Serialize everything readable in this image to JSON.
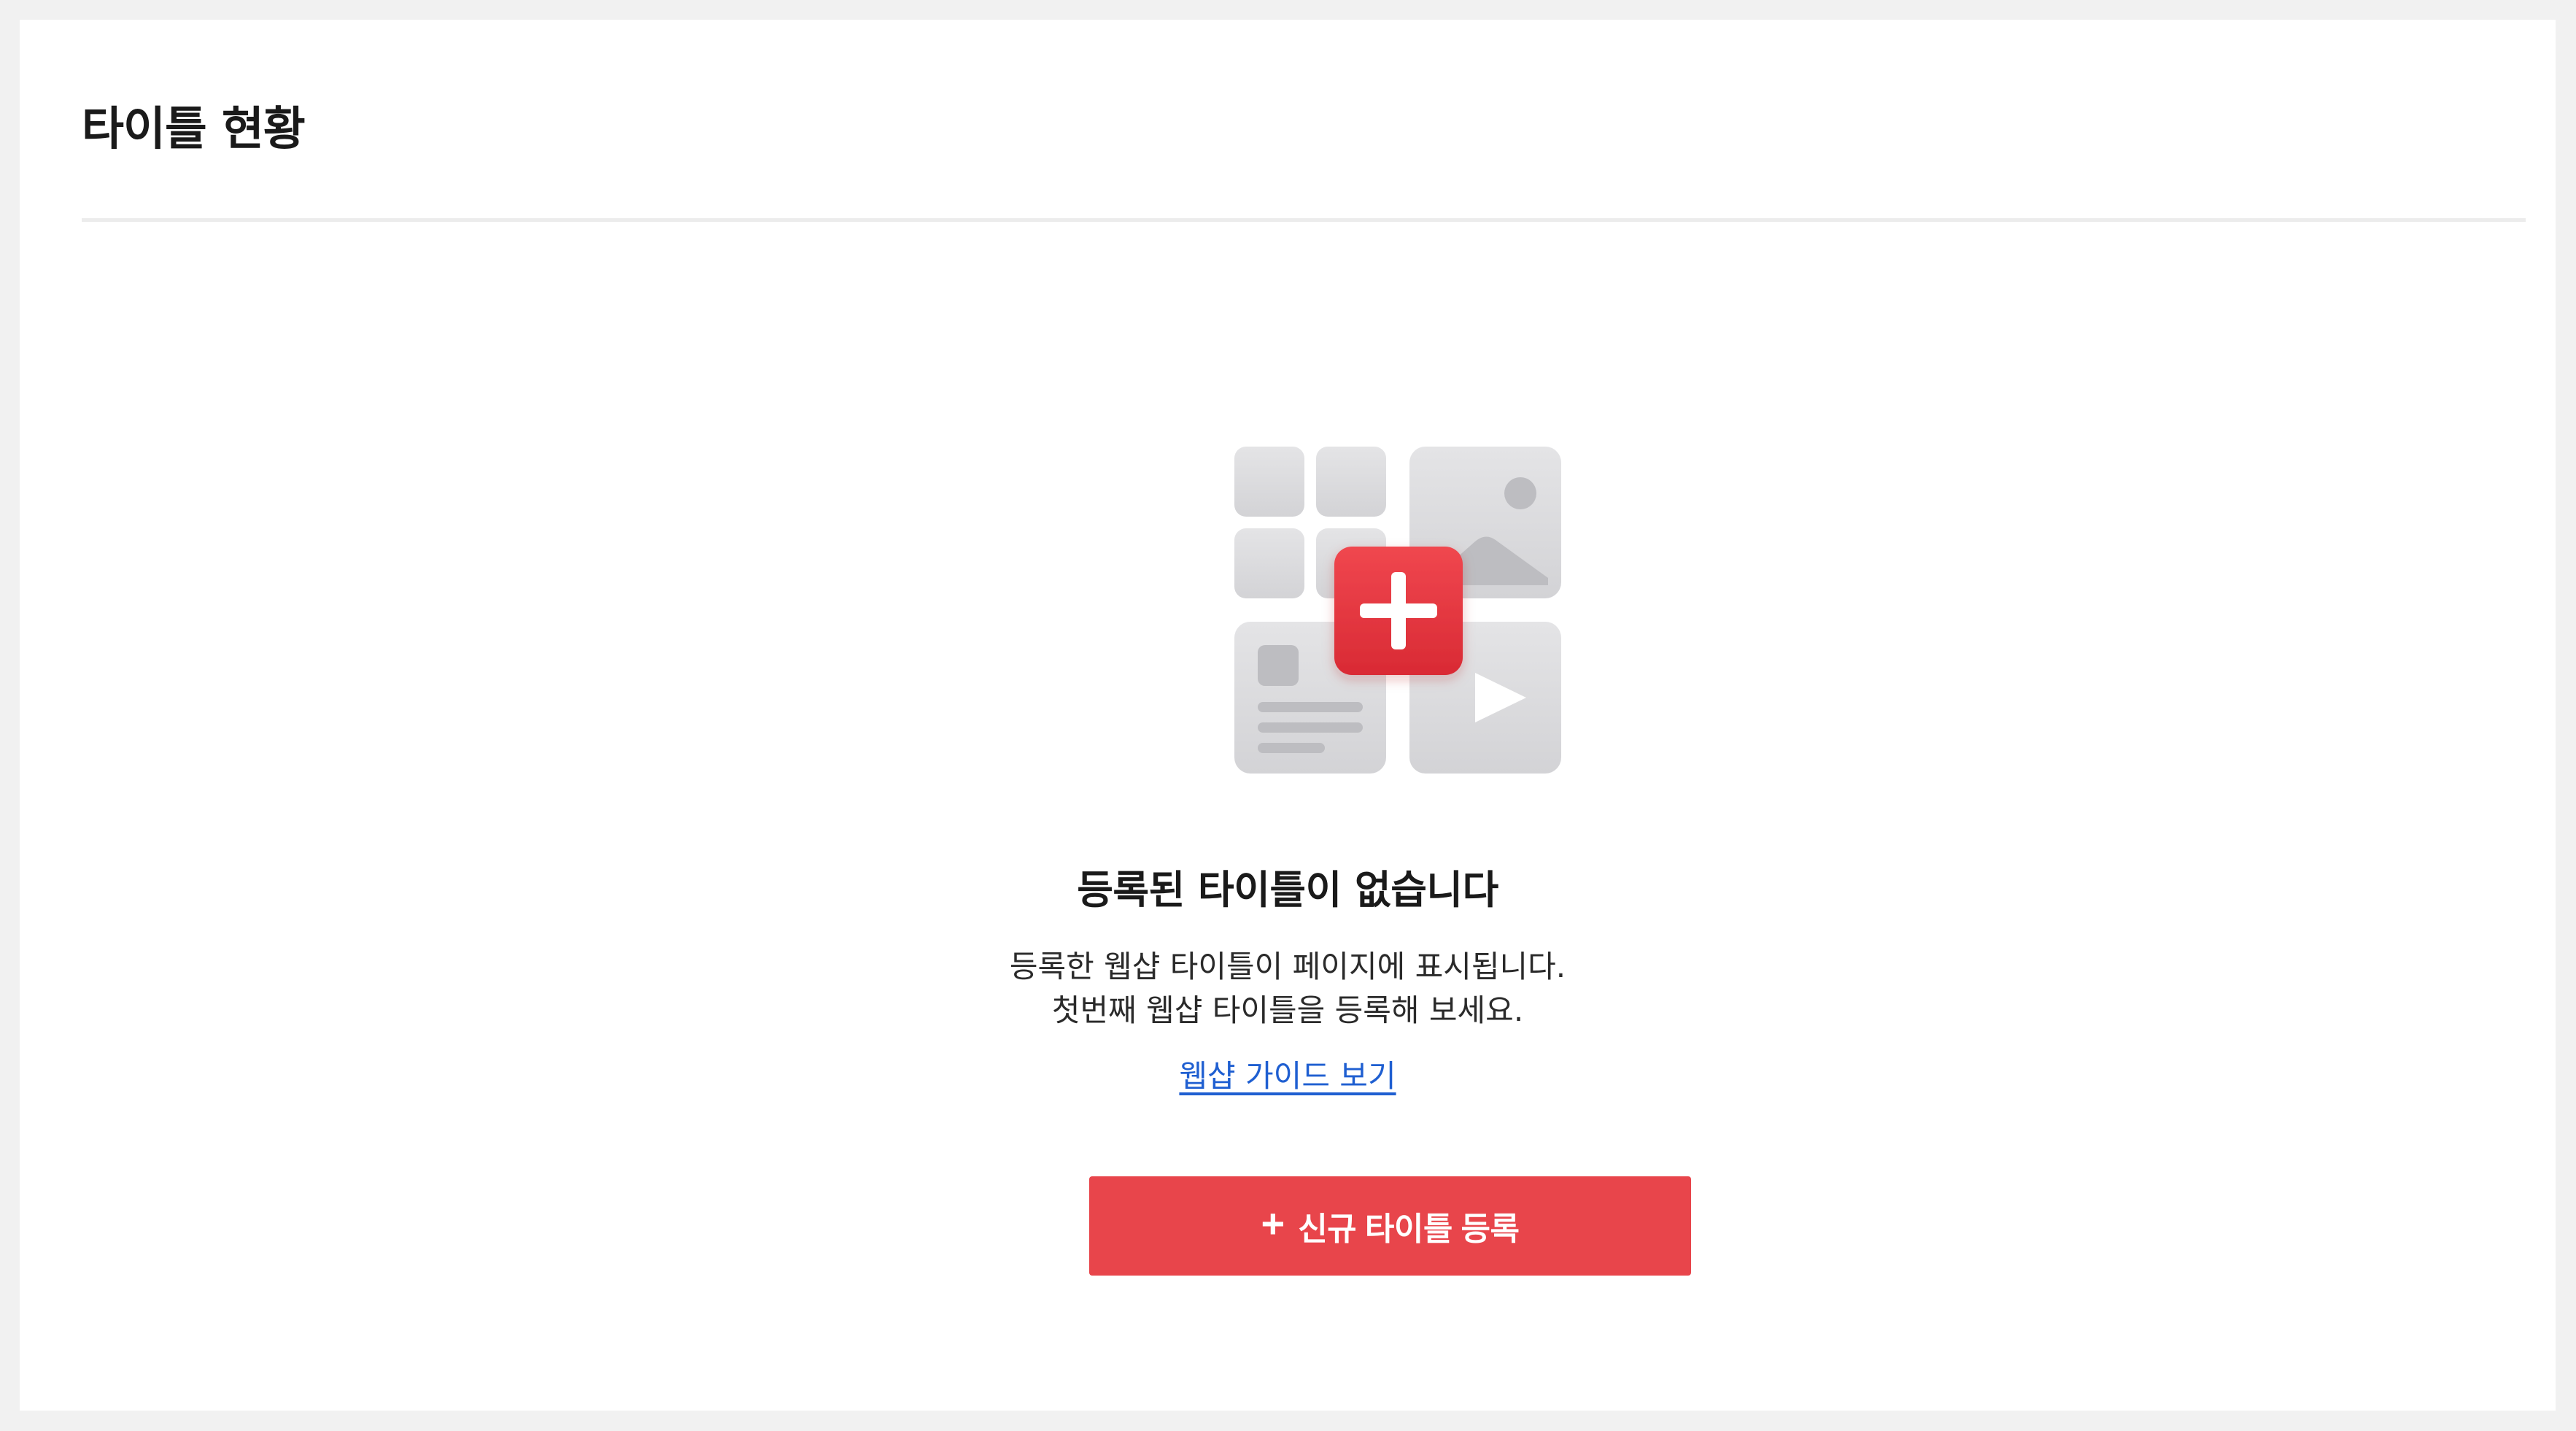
{
  "page": {
    "title": "타이틀 현황"
  },
  "empty_state": {
    "illustration_icon": "add-content-grid-icon",
    "title": "등록된 타이틀이 없습니다",
    "description_line1": "등록한 웹샵 타이틀이 페이지에 표시됩니다.",
    "description_line2": "첫번째 웹샵 타이틀을 등록해 보세요.",
    "guide_link_label": "웹샵 가이드 보기"
  },
  "actions": {
    "register_icon": "plus-icon",
    "register_plus": "+",
    "register_label": "신규 타이틀 등록"
  },
  "colors": {
    "accent": "#e8454b",
    "link": "#1f5fd1",
    "background": "#f1f1f1",
    "surface": "#ffffff"
  }
}
